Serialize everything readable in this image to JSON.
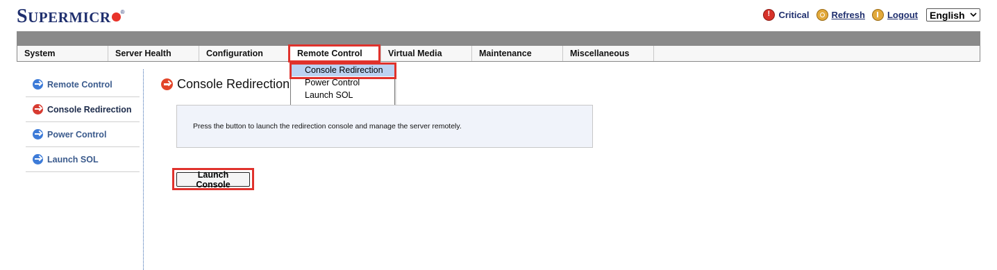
{
  "brand": {
    "logo_text": "SUPERMICRO",
    "logo_first": "S",
    "logo_rest": "UPERMICR",
    "registered": "®"
  },
  "header": {
    "critical_label": "Critical",
    "refresh_label": "Refresh",
    "logout_label": "Logout",
    "language": {
      "selected": "English"
    }
  },
  "menu": {
    "items": [
      {
        "label": "System"
      },
      {
        "label": "Server Health"
      },
      {
        "label": "Configuration"
      },
      {
        "label": "Remote Control"
      },
      {
        "label": "Virtual Media"
      },
      {
        "label": "Maintenance"
      },
      {
        "label": "Miscellaneous"
      }
    ],
    "active": "Remote Control"
  },
  "dropdown": {
    "items": [
      {
        "label": "Console Redirection"
      },
      {
        "label": "Power Control"
      },
      {
        "label": "Launch SOL"
      }
    ],
    "selected": "Console Redirection"
  },
  "sidebar": {
    "items": [
      {
        "label": "Remote Control"
      },
      {
        "label": "Console Redirection"
      },
      {
        "label": "Power Control"
      },
      {
        "label": "Launch SOL"
      }
    ],
    "active": "Console Redirection"
  },
  "main": {
    "title": "Console Redirection",
    "info_text": "Press the button to launch the redirection console and manage the server remotely.",
    "launch_button": "Launch Console"
  },
  "colors": {
    "brand_navy": "#1f2f6e",
    "highlight_red": "#e0322c",
    "link_blue": "#3a5a8c",
    "selected_bg": "#bcd2f2",
    "info_bg": "#f0f3fa"
  }
}
